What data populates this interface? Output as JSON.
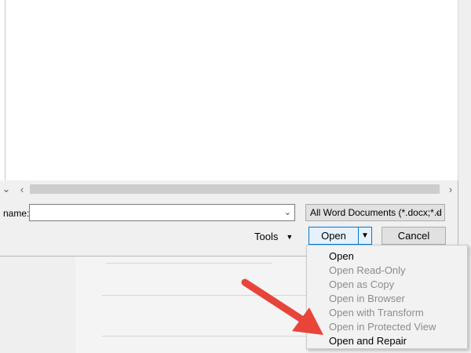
{
  "colors": {
    "accent_blue": "#0078d7",
    "annotation_red": "#e8443a",
    "disabled_text": "#8c8c8c"
  },
  "scrollbar": {
    "left_icon": "chevron-left-icon",
    "right_icon": "chevron-right-icon",
    "down_icon": "chevron-down-icon"
  },
  "file_name": {
    "label": "name:",
    "value": ""
  },
  "file_type": {
    "selected": "All Word Documents (*.docx;*.d"
  },
  "tools": {
    "label": "Tools"
  },
  "buttons": {
    "open": "Open",
    "cancel": "Cancel"
  },
  "open_menu": {
    "items": [
      {
        "label": "Open",
        "enabled": true
      },
      {
        "label": "Open Read-Only",
        "enabled": false
      },
      {
        "label": "Open as Copy",
        "enabled": false
      },
      {
        "label": "Open in Browser",
        "enabled": false
      },
      {
        "label": "Open with Transform",
        "enabled": false
      },
      {
        "label": "Open in Protected View",
        "enabled": false
      },
      {
        "label": "Open and Repair",
        "enabled": true
      }
    ]
  },
  "annotation": {
    "icon": "red-arrow-icon"
  }
}
